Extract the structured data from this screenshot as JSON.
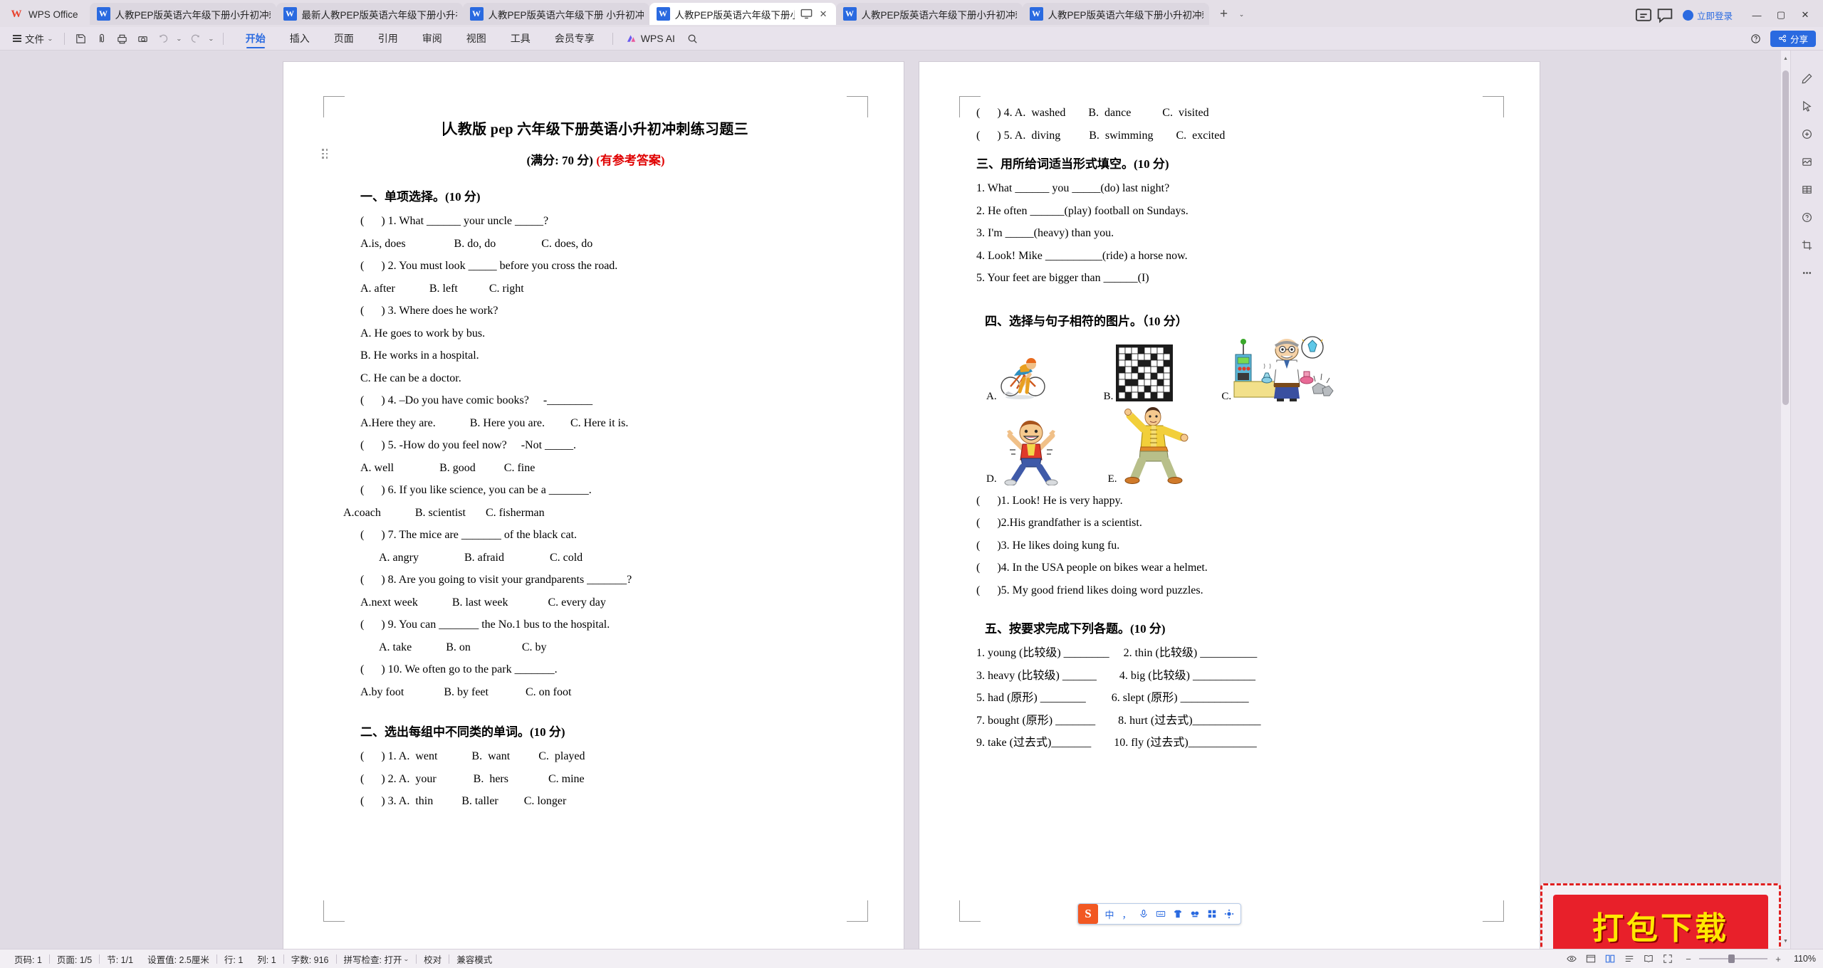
{
  "app": {
    "home_label": "WPS Office",
    "logo_glyph": "W"
  },
  "tabs": [
    {
      "label": "人教PEP版英语六年级下册小升初冲刺",
      "active": false
    },
    {
      "label": "最新人教PEP版英语六年级下册小升初",
      "active": false
    },
    {
      "label": "人教PEP版英语六年级下册 小升初冲刺",
      "active": false
    },
    {
      "label": "人教PEP版英语六年级下册小升初冲刺",
      "active": true
    },
    {
      "label": "人教PEP版英语六年级下册小升初冲刺",
      "active": false
    },
    {
      "label": "人教PEP版英语六年级下册小升初冲刺",
      "active": false
    },
    {
      "label": "人教PEP版英语六年级下册小升初冲刺",
      "active": false
    }
  ],
  "tabbar": {
    "new_tab": "+",
    "tab_list_caret": "⌄",
    "login_label": "立即登录",
    "minimize": "—",
    "maximize": "▢",
    "close": "✕"
  },
  "ribbon": {
    "file_label": "文件",
    "tabs": [
      {
        "label": "开始",
        "active": true
      },
      {
        "label": "插入",
        "active": false
      },
      {
        "label": "页面",
        "active": false
      },
      {
        "label": "引用",
        "active": false
      },
      {
        "label": "审阅",
        "active": false
      },
      {
        "label": "视图",
        "active": false
      },
      {
        "label": "工具",
        "active": false
      },
      {
        "label": "会员专享",
        "active": false
      }
    ],
    "ai_label": "WPS AI",
    "share_label": "分享"
  },
  "document": {
    "title": "人教版 pep 六年级下册英语小升初冲刺练习题三",
    "subtitle_main": "(满分: 70 分)",
    "subtitle_red": "(有参考答案)",
    "left_page": {
      "section1_head": "一、单项选择。(10 分)",
      "section1_lines": [
        {
          "text": "(      ) 1. What ______ your uncle _____?",
          "indent": 1
        },
        {
          "text": "A.is, does                 B. do, do                C. does, do",
          "indent": 1
        },
        {
          "text": "(      ) 2. You must look _____ before you cross the road.",
          "indent": 1
        },
        {
          "text": "A. after            B. left           C. right",
          "indent": 1
        },
        {
          "text": "(      ) 3. Where does he work?",
          "indent": 1
        },
        {
          "text": "A. He goes to work by bus.",
          "indent": 1
        },
        {
          "text": "B. He works in a hospital.",
          "indent": 1
        },
        {
          "text": "C. He can be a doctor.",
          "indent": 1
        },
        {
          "text": "(      ) 4. –Do you have comic books?     -________",
          "indent": 1
        },
        {
          "text": "A.Here they are.            B. Here you are.         C. Here it is.",
          "indent": 1
        },
        {
          "text": "(      ) 5. -How do you feel now?     -Not _____.",
          "indent": 1
        },
        {
          "text": "A. well                B. good          C. fine",
          "indent": 1
        },
        {
          "text": "(      ) 6. If you like science, you can be a _______.",
          "indent": 1
        },
        {
          "text": "A.coach            B. scientist       C. fisherman",
          "indent": 0
        },
        {
          "text": "(      ) 7. The mice are _______ of the black cat.",
          "indent": 1
        },
        {
          "text": "A. angry                B. afraid                C. cold",
          "indent": 2
        },
        {
          "text": "(      ) 8. Are you going to visit your grandparents _______?",
          "indent": 1
        },
        {
          "text": "A.next week            B. last week              C. every day",
          "indent": 1
        },
        {
          "text": "(      ) 9. You can _______ the No.1 bus to the hospital.",
          "indent": 1
        },
        {
          "text": "A. take            B. on                  C. by",
          "indent": 2
        },
        {
          "text": "(      ) 10. We often go to the park _______.",
          "indent": 1
        },
        {
          "text": "A.by foot              B. by feet             C. on foot",
          "indent": 1
        }
      ],
      "section2_head": "二、选出每组中不同类的单词。(10 分)",
      "section2_lines": [
        {
          "text": "(      ) 1. A.  went            B.  want          C.  played",
          "indent": 1
        },
        {
          "text": "(      ) 2. A.  your             B.  hers              C. mine",
          "indent": 1
        },
        {
          "text": "(      ) 3. A.  thin          B. taller         C. longer",
          "indent": 1
        }
      ]
    },
    "right_page": {
      "section2_cont": [
        {
          "text": "(      ) 4. A.  washed        B.  dance           C.  visited",
          "indent": 0
        },
        {
          "text": "(      ) 5. A.  diving          B.  swimming        C.  excited",
          "indent": 0
        }
      ],
      "section3_head": "三、用所给词适当形式填空。(10 分)",
      "section3_lines": [
        "1. What ______ you _____(do) last night?",
        "2. He often ______(play) football on Sundays.",
        "3. I'm _____(heavy) than you.",
        "4. Look! Mike __________(ride) a horse now.",
        "5. Your feet are bigger than ______(I)"
      ],
      "section4_head": "四、选择与句子相符的图片。（10 分）",
      "picture_labels": [
        "A.",
        "B.",
        "C.",
        "D.",
        "E."
      ],
      "picture_alts": [
        "cyclist-image",
        "crossword-puzzle-image",
        "scientist-image",
        "happy-boy-image",
        "kung-fu-man-image"
      ],
      "section4_lines": [
        "(      )1. Look! He is very happy.",
        "(      )2.His grandfather is a scientist.",
        "(      )3. He likes doing kung fu.",
        "(      )4. In the USA people on bikes wear a helmet.",
        "(      )5. My good friend likes doing word puzzles."
      ],
      "section5_head": "五、按要求完成下列各题。(10 分)",
      "section5_lines": [
        "1. young (比较级) ________     2. thin (比较级) __________",
        "3. heavy (比较级) ______        4. big (比较级) ___________",
        "5. had (原形) ________         6. slept (原形) ____________",
        "7. bought (原形) _______        8. hurt (过去式)____________",
        "9. take (过去式)_______        10. fly (过去式)____________"
      ]
    }
  },
  "ime": {
    "logo": "S",
    "items": [
      "中",
      "，",
      "mic-icon",
      "keyboard-icon",
      "skin-icon",
      "emoji-icon",
      "grid-icon",
      "settings-icon"
    ]
  },
  "watermark": {
    "label": "打包下载"
  },
  "statusbar": {
    "page_no_label": "页码: 1",
    "page_count_label": "页面: 1/5",
    "section_label": "节: 1/1",
    "setting_label": "设置值: 2.5厘米",
    "row_label": "行: 1",
    "col_label": "列: 1",
    "word_count_label": "字数: 916",
    "spellcheck_label": "拼写检查: 打开",
    "proof_label": "校对",
    "compat_label": "兼容模式",
    "zoom_label": "110%",
    "zoom_minus": "−",
    "zoom_plus": "+"
  }
}
